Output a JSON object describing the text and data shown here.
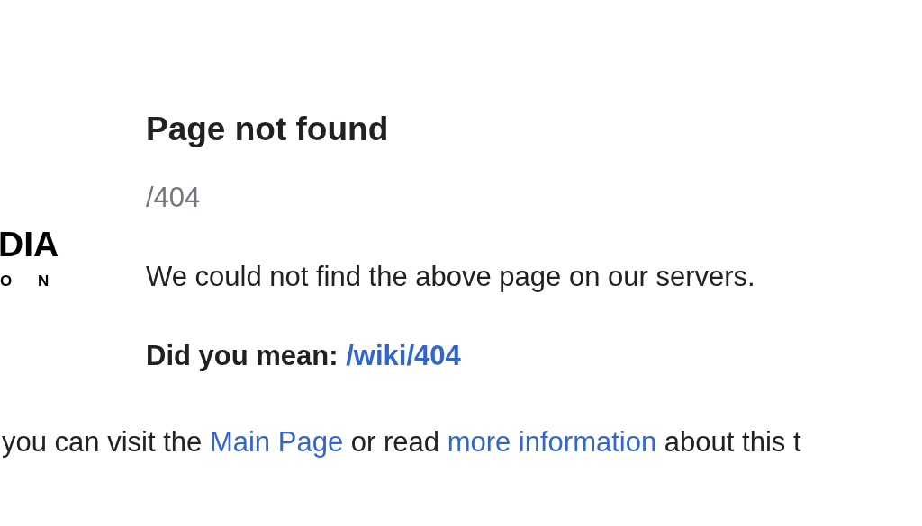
{
  "logo": {
    "wordmark": "DIA",
    "subtitle": "O N"
  },
  "title": "Page not found",
  "path": "/404",
  "message": "We could not find the above page on our servers.",
  "suggestion": {
    "label": "Did you mean:",
    "link": "/wiki/404"
  },
  "footer_sentence": [
    {
      "kind": "text",
      "text": "you can visit the"
    },
    {
      "kind": "link",
      "text": "Main Page"
    },
    {
      "kind": "text",
      "text": "or read"
    },
    {
      "kind": "link",
      "text": "more information"
    },
    {
      "kind": "text",
      "text": "about this t"
    }
  ]
}
